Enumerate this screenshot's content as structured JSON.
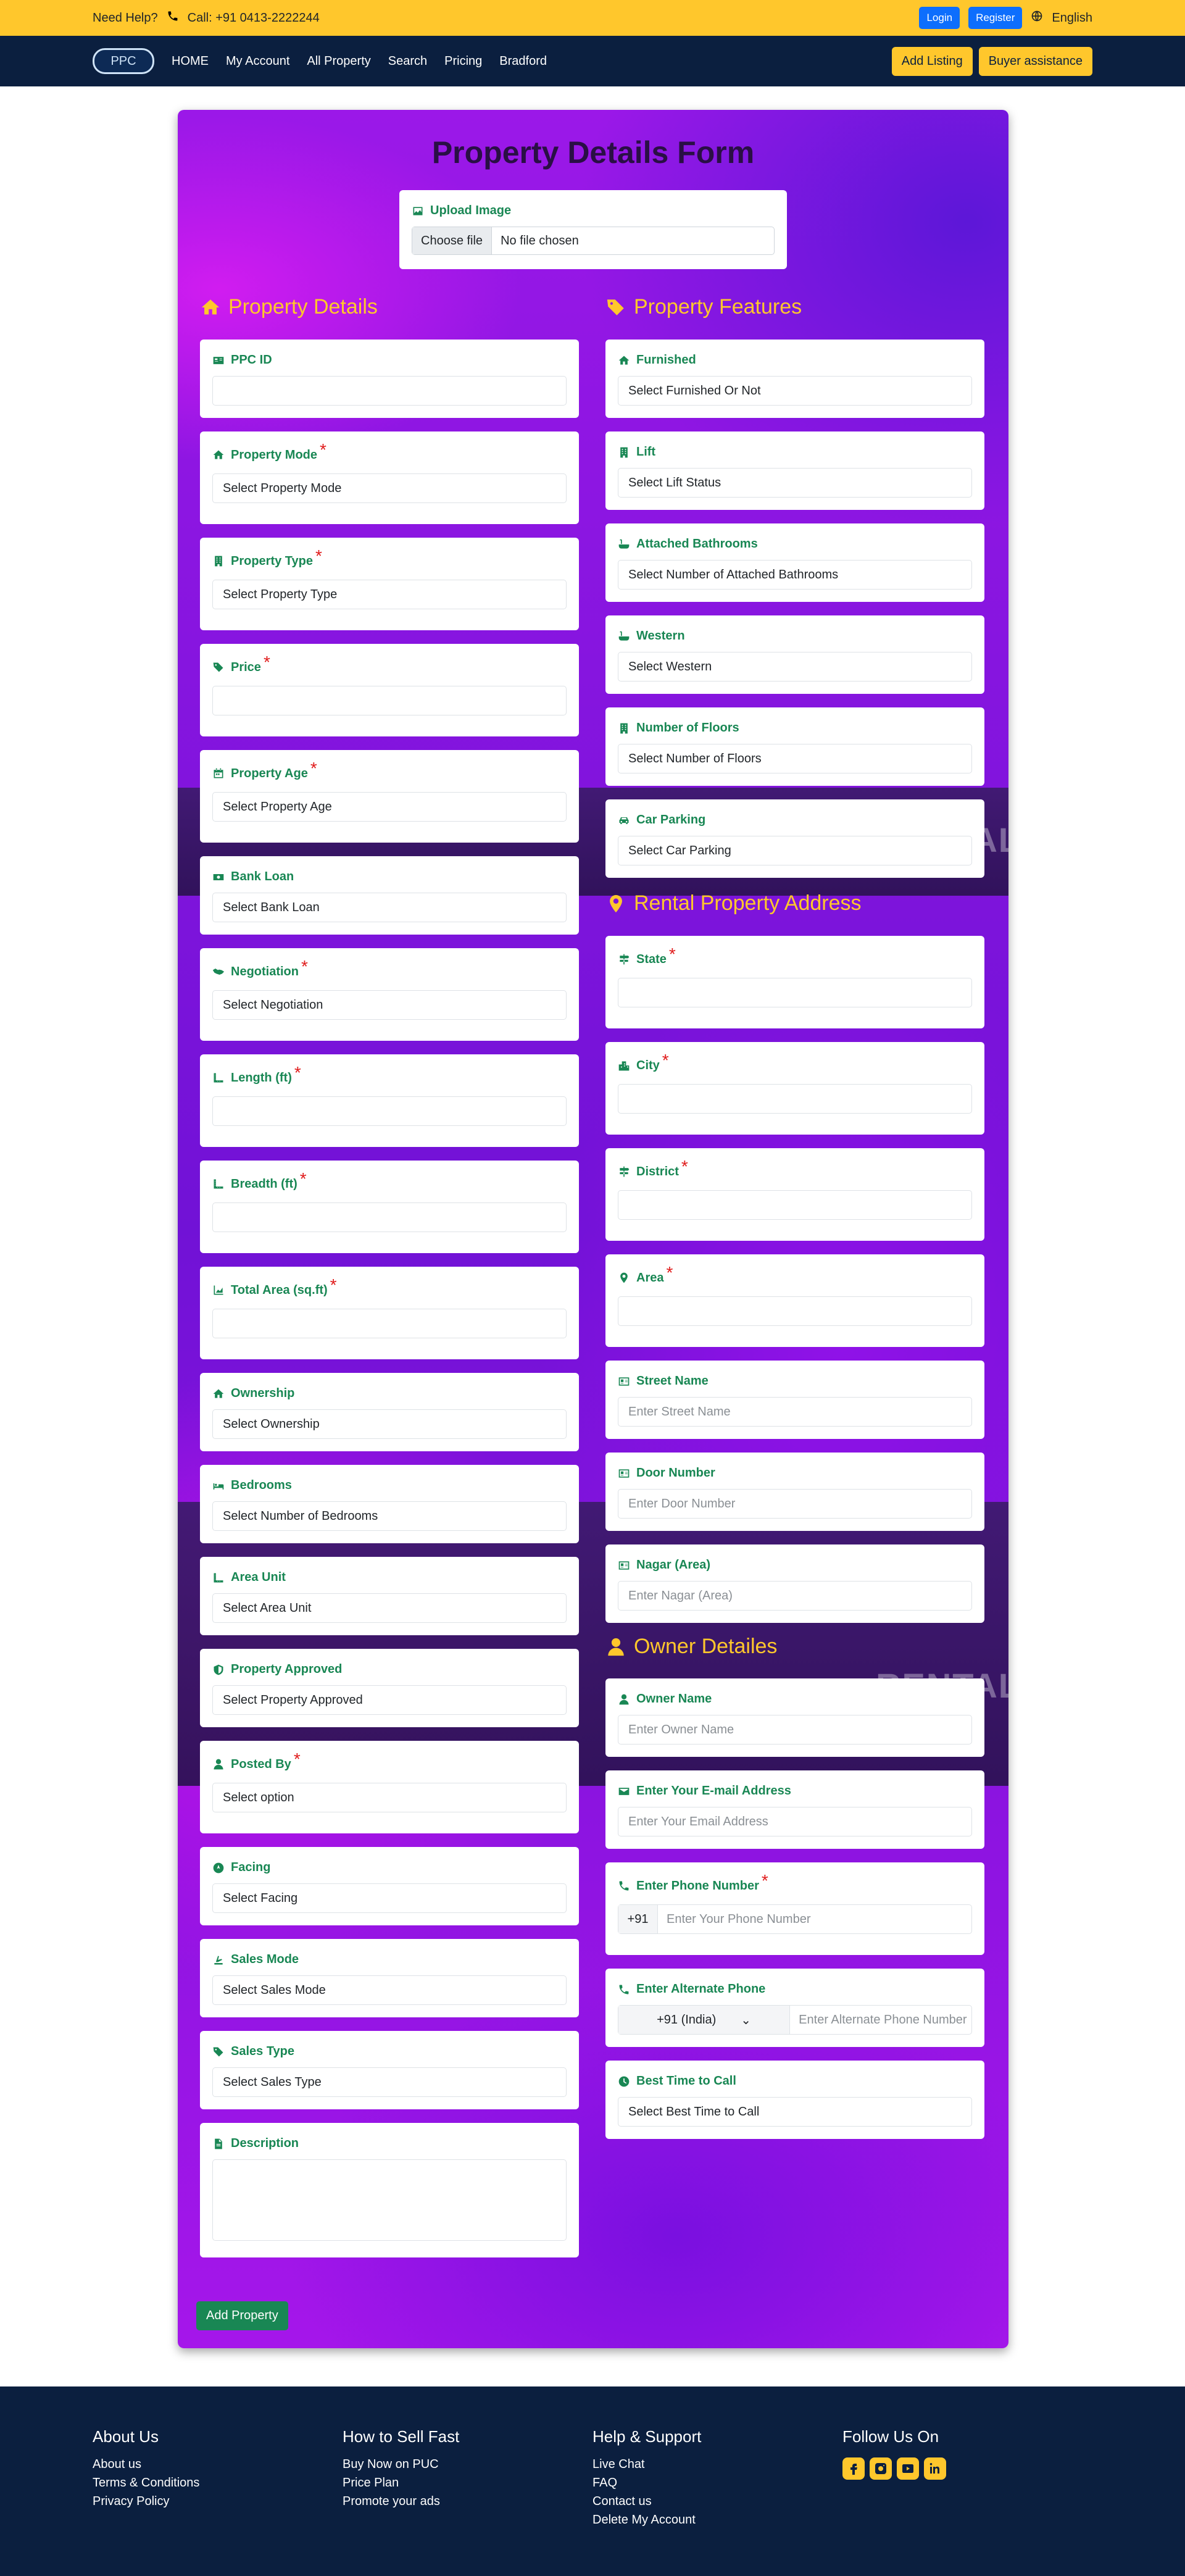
{
  "topbar": {
    "need_help": "Need Help?",
    "call": "Call: +91 0413-2222244",
    "login": "Login",
    "register": "Register",
    "language": "English"
  },
  "nav": {
    "logo": "PPC",
    "items": [
      "HOME",
      "My Account",
      "All Property",
      "Search",
      "Pricing",
      "Bradford"
    ],
    "add_listing": "Add Listing",
    "buyer_assistance": "Buyer assistance"
  },
  "form": {
    "title": "Property Details Form",
    "upload_label": "Upload Image",
    "choose_file": "Choose file",
    "no_file": "No file chosen",
    "bg_text": "RENTAL",
    "submit": "Add Property"
  },
  "sections": {
    "details": "Property Details",
    "features": "Property Features",
    "address": "Rental Property Address",
    "owner": "Owner Detailes"
  },
  "left_fields": [
    {
      "label": "PPC ID",
      "value": "",
      "req": false,
      "icon": "id-card-icon"
    },
    {
      "label": "Property Mode",
      "value": "Select Property Mode",
      "req": true,
      "icon": "home-icon"
    },
    {
      "label": "Property Type",
      "value": "Select Property Type",
      "req": true,
      "icon": "building-icon"
    },
    {
      "label": "Price",
      "value": "",
      "req": true,
      "icon": "tag-icon"
    },
    {
      "label": "Property Age",
      "value": "Select Property Age",
      "req": true,
      "icon": "calendar-icon"
    },
    {
      "label": "Bank Loan",
      "value": "Select Bank Loan",
      "req": false,
      "icon": "money-icon"
    },
    {
      "label": "Negotiation",
      "value": "Select Negotiation",
      "req": true,
      "icon": "handshake-icon"
    },
    {
      "label": "Length (ft)",
      "value": "",
      "req": true,
      "icon": "ruler-icon"
    },
    {
      "label": "Breadth (ft)",
      "value": "",
      "req": true,
      "icon": "ruler-icon"
    },
    {
      "label": "Total Area (sq.ft)",
      "value": "",
      "req": true,
      "icon": "chart-area-icon"
    },
    {
      "label": "Ownership",
      "value": "Select Ownership",
      "req": false,
      "icon": "home-icon"
    },
    {
      "label": "Bedrooms",
      "value": "Select Number of Bedrooms",
      "req": false,
      "icon": "bed-icon"
    },
    {
      "label": "Area Unit",
      "value": "Select Area Unit",
      "req": false,
      "icon": "ruler-icon"
    },
    {
      "label": "Property Approved",
      "value": "Select Property Approved",
      "req": false,
      "icon": "shield-icon"
    },
    {
      "label": "Posted By",
      "value": "Select option",
      "req": true,
      "icon": "user-icon"
    },
    {
      "label": "Facing",
      "value": "Select Facing",
      "req": false,
      "icon": "compass-icon"
    },
    {
      "label": "Sales Mode",
      "value": "Select Sales Mode",
      "req": false,
      "icon": "hand-icon"
    },
    {
      "label": "Sales Type",
      "value": "Select Sales Type",
      "req": false,
      "icon": "tag-icon"
    },
    {
      "label": "Description",
      "value": "",
      "req": false,
      "icon": "file-icon"
    }
  ],
  "feature_fields": [
    {
      "label": "Furnished",
      "value": "Select Furnished Or Not",
      "icon": "home-icon"
    },
    {
      "label": "Lift",
      "value": "Select Lift Status",
      "icon": "building-icon"
    },
    {
      "label": "Attached Bathrooms",
      "value": "Select Number of Attached Bathrooms",
      "icon": "bath-icon"
    },
    {
      "label": "Western",
      "value": "Select Western",
      "icon": "bath-icon"
    },
    {
      "label": "Number of Floors",
      "value": "Select Number of Floors",
      "icon": "building-icon"
    },
    {
      "label": "Car Parking",
      "value": "Select Car Parking",
      "icon": "car-icon"
    }
  ],
  "address_fields": [
    {
      "label": "State",
      "value": "",
      "req": true,
      "icon": "signpost-icon"
    },
    {
      "label": "City",
      "value": "",
      "req": true,
      "icon": "city-icon"
    },
    {
      "label": "District",
      "value": "",
      "req": true,
      "icon": "signpost-icon"
    },
    {
      "label": "Area",
      "value": "",
      "req": true,
      "icon": "map-pin-icon"
    },
    {
      "label": "Street Name",
      "value": "Enter Street Name",
      "req": false,
      "icon": "address-card-icon"
    },
    {
      "label": "Door Number",
      "value": "Enter Door Number",
      "req": false,
      "icon": "address-card-icon"
    },
    {
      "label": "Nagar (Area)",
      "value": "Enter Nagar (Area)",
      "req": false,
      "icon": "address-card-icon"
    }
  ],
  "owner": {
    "name_label": "Owner Name",
    "name_ph": "Enter Owner Name",
    "email_label": "Enter Your E-mail Address",
    "email_ph": "Enter Your Email Address",
    "phone_label": "Enter Phone Number",
    "phone_code": "+91",
    "phone_ph": "Enter Your Phone Number",
    "alt_label": "Enter Alternate Phone",
    "alt_code": "+91 (India)",
    "alt_ph": "Enter Alternate Phone Number",
    "time_label": "Best Time to Call",
    "time_value": "Select Best Time to Call"
  },
  "footer": {
    "about": {
      "title": "About Us",
      "links": [
        "About us",
        "Terms & Conditions",
        "Privacy Policy"
      ]
    },
    "sell": {
      "title": "How to Sell Fast",
      "links": [
        "Buy Now on PUC",
        "Price Plan",
        "Promote your ads"
      ]
    },
    "help": {
      "title": "Help & Support",
      "links": [
        "Live Chat",
        "FAQ",
        "Contact us",
        "Delete My Account"
      ]
    },
    "follow": {
      "title": "Follow Us On"
    }
  },
  "colors": {
    "topbar": "#ffc72c",
    "navbar": "#0b1f3f",
    "label": "#198754",
    "heading": "#ffc72c",
    "required": "#e01c1c"
  }
}
